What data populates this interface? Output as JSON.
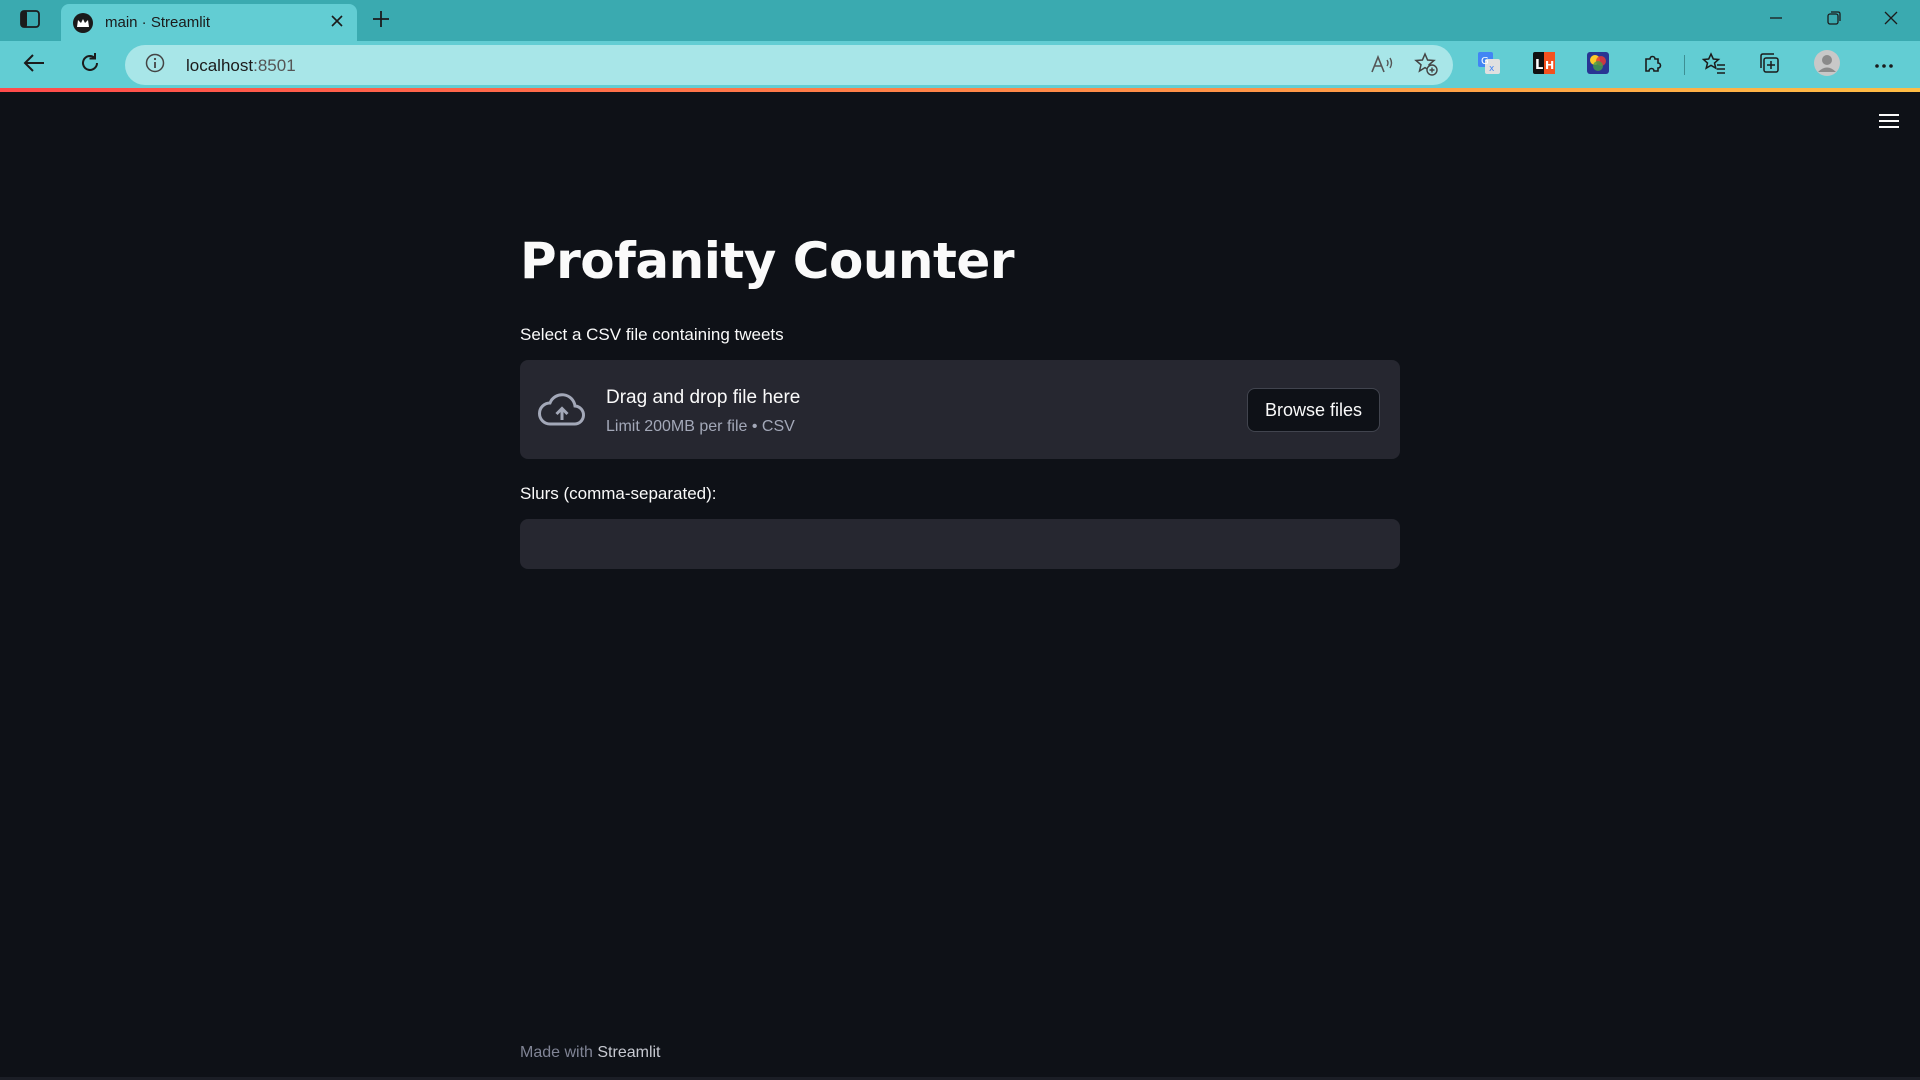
{
  "browser": {
    "tab_title": "main · Streamlit",
    "url_host": "localhost",
    "url_port": ":8501"
  },
  "app": {
    "title": "Profanity Counter",
    "uploader": {
      "label": "Select a CSV file containing tweets",
      "drag_text": "Drag and drop file here",
      "limit_text": "Limit 200MB per file • CSV",
      "browse_label": "Browse files"
    },
    "slurs_input": {
      "label": "Slurs (comma-separated):",
      "value": ""
    },
    "footer": {
      "prefix": "Made with ",
      "brand": "Streamlit"
    }
  },
  "icons": {
    "tab_actions": "tab-actions-icon",
    "favicon": "streamlit-crown-icon",
    "close": "close-icon",
    "new_tab": "plus-icon",
    "back": "back-arrow-icon",
    "reload": "reload-icon",
    "info": "info-icon",
    "read_aloud": "read-aloud-icon",
    "add_favorite": "star-plus-icon",
    "translate_ext": "translate-extension-icon",
    "lh_ext": "lighthouse-extension-icon",
    "color_ext": "color-extension-icon",
    "extensions": "puzzle-icon",
    "favorites": "favorites-icon",
    "collections": "collections-icon",
    "profile": "profile-icon",
    "more": "more-icon",
    "hamburger": "hamburger-menu-icon",
    "upload_cloud": "cloud-upload-icon"
  },
  "colors": {
    "app_bg": "#0e1117",
    "widget_bg": "#262730",
    "text": "#fafafa",
    "muted_text": "#a3a8b8",
    "chrome_tab_bar": "#3aaab0",
    "chrome_toolbar": "#62cdd3",
    "address_bar": "#a8e6e8",
    "accent_gradient_start": "#ff4b4b",
    "accent_gradient_end": "#ffbd45"
  }
}
